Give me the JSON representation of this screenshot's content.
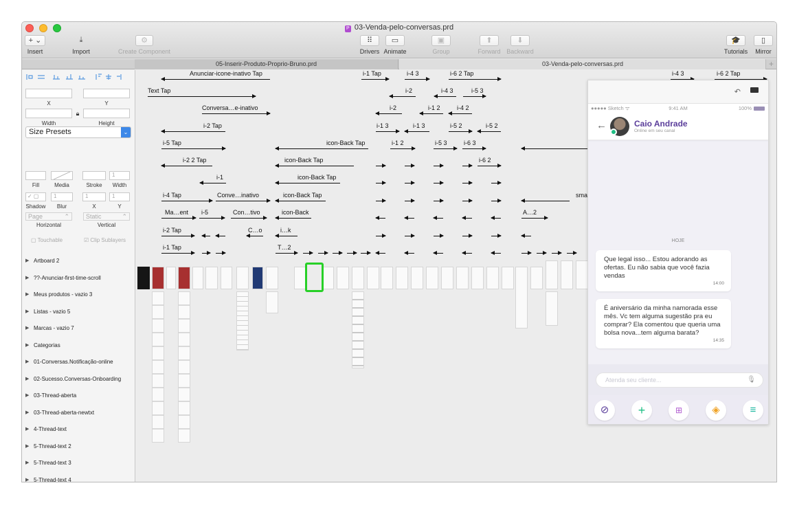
{
  "window": {
    "title": "03-Venda-pelo-conversas.prd",
    "doc_icon": "P"
  },
  "toolbar": {
    "insert": {
      "label": "Insert",
      "icon": "+ ⌄"
    },
    "import": {
      "label": "Import",
      "icon": "⤓"
    },
    "create_component": {
      "label": "Create Component",
      "icon": "⚙"
    },
    "drivers": {
      "label": "Drivers",
      "icon": "⠿"
    },
    "animate": {
      "label": "Animate",
      "icon": "▭"
    },
    "group": {
      "label": "Group",
      "icon": "▣"
    },
    "forward": {
      "label": "Forward",
      "icon": "⬆"
    },
    "backward": {
      "label": "Backward",
      "icon": "⬇"
    },
    "tutorials": {
      "label": "Tutorials",
      "icon": "🎓"
    },
    "mirror": {
      "label": "Mirror",
      "icon": "▯"
    }
  },
  "tabs": [
    {
      "label": "05-Inserir-Produto-Proprio-Bruno.prd"
    },
    {
      "label": "03-Venda-pelo-conversas.prd"
    }
  ],
  "tab_plus": "+",
  "inspector": {
    "x_label": "X",
    "y_label": "Y",
    "width_label": "Width",
    "height_label": "Height",
    "size_presets": "Size Presets",
    "fill_label": "Fill",
    "media_label": "Media",
    "stroke_label": "Stroke",
    "stroke_width_label": "Width",
    "stroke_width_value": "1",
    "shadow_label": "Shadow",
    "blur_label": "Blur",
    "shadow_x_label": "X",
    "shadow_y_label": "Y",
    "blur_value": "1",
    "shadow_x_value": "1",
    "shadow_y_value": "1",
    "horizontal_select": "Page",
    "vertical_select": "Static",
    "horizontal_label": "Horizontal",
    "vertical_label": "Vertical",
    "touchable_label": "Touchable",
    "clip_label": "Clip Sublayers"
  },
  "layers": [
    "Artboard 2",
    "??-Anunciar-first-time-scroll",
    "Meus produtos - vazio 3",
    "Listas - vazio 5",
    "Marcas - vazio 7",
    "Categorias",
    "01-Conversas.Notificação-online",
    "02-Sucesso.Conversas-Onboarding",
    "03-Thread-aberta",
    "03-Thread-aberta-newtxt",
    "4-Thread-text",
    "5-Thread-text 2",
    "5-Thread-text 3",
    "5-Thread-text 4"
  ],
  "canvas_links": {
    "anunciar": "Anunciar-icone-inativo Tap",
    "text_tap": "Text Tap",
    "conversa": "Conversa…e-inativo",
    "i2_tap": "i-2 Tap",
    "i5_tap": "i-5 Tap",
    "i22_tap": "i-2 2 Tap",
    "i1": "i-1",
    "i4_tap": "i-4 Tap",
    "conve": "Conve…inativo",
    "ma_ent": "Ma…ent",
    "i5": "i-5",
    "con_tivo": "Con…tivo",
    "i2_tap2": "i-2 Tap",
    "c_o": "C…o",
    "i1_tap": "i-1 Tap",
    "icon_back_tap": "icon-Back Tap",
    "icon_back": "icon-Back",
    "i_k": "i…k",
    "t_2": "T…2",
    "i1_tap_top": "i-1 Tap",
    "i43": "i-4 3",
    "i62_tap": "i-6 2 Tap",
    "i2": "i-2",
    "i43b": "i-4 3",
    "i53": "i-5 3",
    "i12": "i-1 2",
    "i42": "i-4 2",
    "i13": "i-1 3",
    "i52": "i-5 2",
    "i63": "i-6 3",
    "i62": "i-6 2",
    "a_2": "A…2",
    "sma": "sma",
    "i43r": "i-4 3",
    "i62_tap_r": "i-6 2 Tap"
  },
  "phone": {
    "status_left": "●●●●● Sketch ᯤ",
    "status_time": "9:41 AM",
    "status_battery": "100%",
    "contact_name": "Caio Andrade",
    "contact_status": "Online em seu canal",
    "day_label": "HOJE",
    "messages": [
      {
        "text": "Que legal isso... Estou adorando as ofertas. Eu não sabia que você fazia vendas",
        "time": "14:00"
      },
      {
        "text": "É aniversário da minha namorada esse mês. Vc tem alguma sugestão pra eu comprar? Ela comentou que queria uma bolsa nova...tem alguma barata?",
        "time": "14:35"
      }
    ],
    "input_placeholder": "Atenda seu cliente...",
    "accent": "#5a3d9a",
    "green": "#1fbf84",
    "orange": "#f0a326",
    "blue": "#5a78e0"
  }
}
